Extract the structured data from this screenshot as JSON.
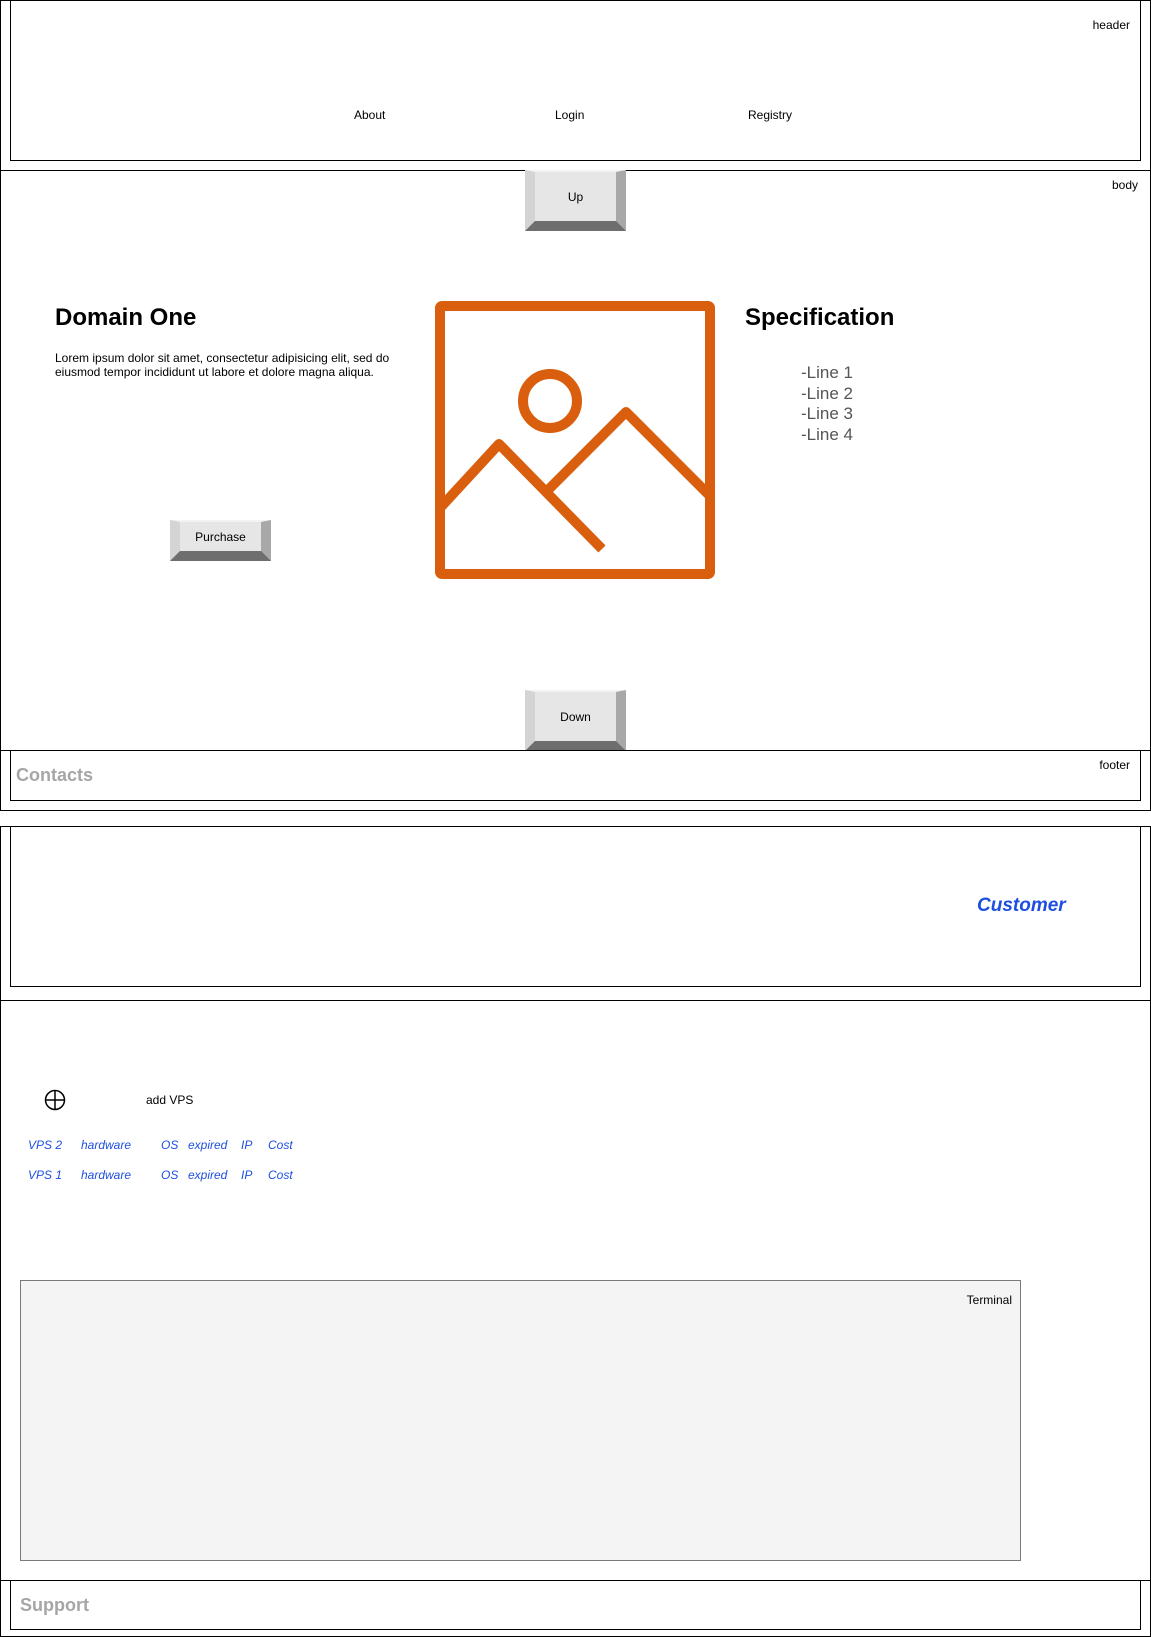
{
  "header": {
    "tag": "header",
    "nav": [
      "About",
      "Login",
      "Registry"
    ]
  },
  "body_section": {
    "tag": "body",
    "up_label": "Up",
    "down_label": "Down",
    "product": {
      "title": "Domain One",
      "description": "Lorem ipsum dolor sit amet, consectetur adipisicing elit, sed do eiusmod tempor incididunt ut labore et dolore magna aliqua.",
      "purchase_label": "Purchase"
    },
    "image": {
      "icon": "image-placeholder-icon",
      "color": "#d95f0e"
    },
    "specification": {
      "title": "Specification",
      "lines": [
        "-Line 1",
        "-Line 2",
        "-Line 3",
        "-Line 4"
      ]
    }
  },
  "footer": {
    "tag": "footer",
    "title": "Contacts"
  },
  "customer_header": {
    "title": "Customer",
    "color": "#1e4fe0"
  },
  "vps": {
    "add_label": "add VPS",
    "add_icon": "circle-plus-icon",
    "rows": [
      {
        "name": "VPS 2",
        "hardware": "hardware",
        "os": "OS",
        "expired": "expired",
        "ip": "IP",
        "cost": "Cost"
      },
      {
        "name": "VPS 1",
        "hardware": "hardware",
        "os": "OS",
        "expired": "expired",
        "ip": "IP",
        "cost": "Cost"
      }
    ]
  },
  "terminal": {
    "tag": "Terminal"
  },
  "support": {
    "title": "Support"
  }
}
